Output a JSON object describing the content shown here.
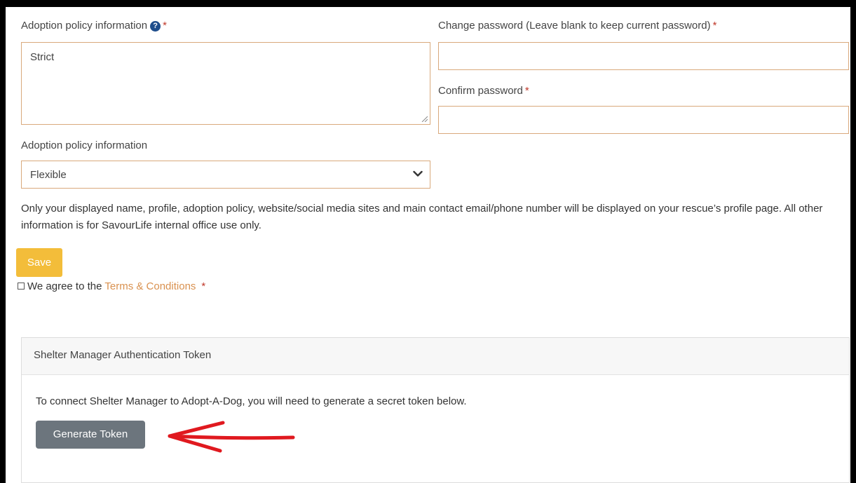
{
  "form": {
    "adoption_policy_label": "Adoption policy information",
    "adoption_policy_value": "Strict",
    "adoption_policy_select_label": "Adoption policy information",
    "adoption_policy_select_value": "Flexible",
    "change_password_label": "Change password (Leave blank to keep current password)",
    "confirm_password_label": "Confirm password",
    "required_mark": "*",
    "help_icon_glyph": "?"
  },
  "notice": {
    "text": "Only your displayed name, profile, adoption policy, website/social media sites and main contact email/phone number will be displayed on your rescue’s profile page. All other information is for SavourLife internal office use only."
  },
  "actions": {
    "save_label": "Save",
    "agree_prefix": "We agree to the ",
    "terms_link": "Terms & Conditions"
  },
  "token_card": {
    "title": "Shelter Manager Authentication Token",
    "description": "To connect Shelter Manager to Adopt-A-Dog, you will need to generate a secret token below.",
    "button_label": "Generate Token"
  },
  "colors": {
    "field_border": "#d9a97c",
    "save_button": "#f3bd3a",
    "link": "#d9914f",
    "required": "#c0392b",
    "token_button": "#6c757d",
    "annotation_arrow": "#e0191f"
  },
  "icons": [
    "help-icon",
    "chevron-down-icon",
    "checkbox-icon",
    "resize-grip-icon",
    "red-arrow-icon"
  ]
}
